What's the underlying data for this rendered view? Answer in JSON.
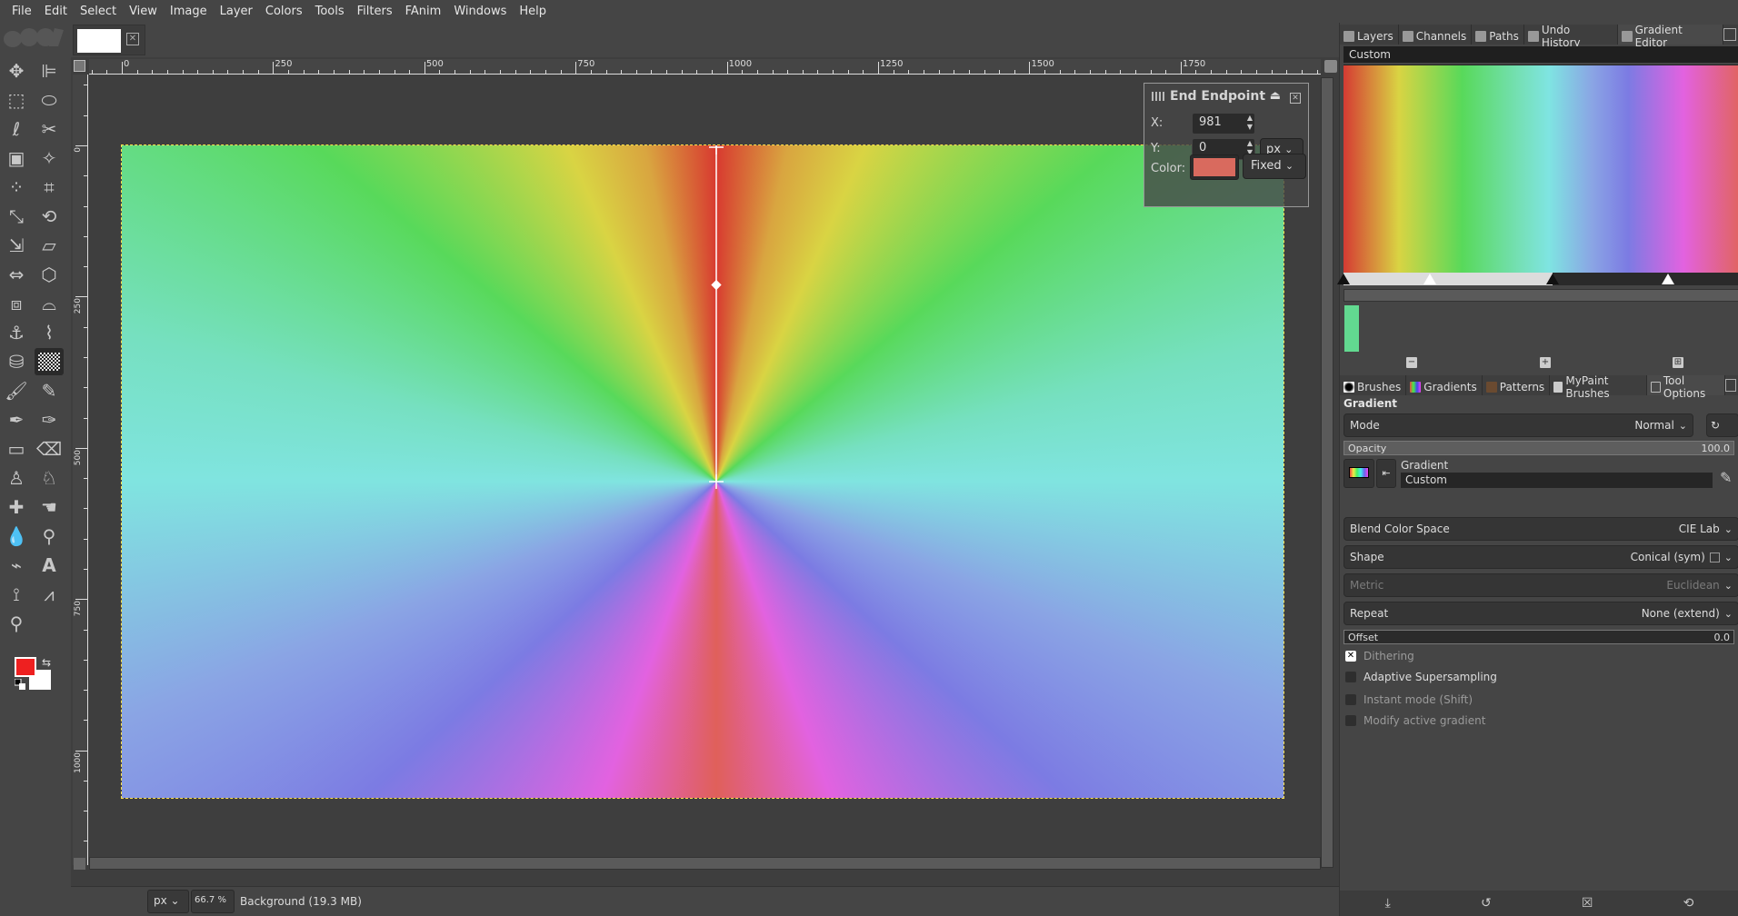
{
  "menubar": [
    "File",
    "Edit",
    "Select",
    "View",
    "Image",
    "Layer",
    "Colors",
    "Tools",
    "Filters",
    "FAnim",
    "Windows",
    "Help"
  ],
  "image_tab": {
    "close_icon": "close-box-icon"
  },
  "ruler": {
    "top_labels": [
      "0",
      "250",
      "500",
      "750",
      "1000",
      "1250",
      "1500",
      "1750"
    ],
    "left_labels": [
      "0",
      "250",
      "500",
      "750",
      "1000"
    ]
  },
  "end_endpoint": {
    "title": "End Endpoint",
    "x_label": "X:",
    "x_value": "981",
    "y_label": "Y:",
    "y_value": "0",
    "unit": "px",
    "color_label": "Color:",
    "color": "#d96a5e",
    "color_mode": "Fixed"
  },
  "statusbar": {
    "unit": "px",
    "zoom": "66.7 %",
    "layer_info": "Background (19.3 MB)"
  },
  "colors": {
    "foreground": "#ee2020",
    "background": "#ffffff"
  },
  "top_dock": {
    "tabs": [
      "Layers",
      "Channels",
      "Paths",
      "Undo History",
      "Gradient Editor"
    ],
    "active_tab": "Gradient Editor",
    "gradient_name": "Custom",
    "stop_swatch_color": "#62d990"
  },
  "bottom_dock": {
    "tabs": [
      "Brushes",
      "Gradients",
      "Patterns",
      "MyPaint Brushes",
      "Tool Options"
    ],
    "active_tab": "Tool Options"
  },
  "tool_options": {
    "title": "Gradient",
    "mode_label": "Mode",
    "mode_value": "Normal",
    "opacity_label": "Opacity",
    "opacity_value": "100.0",
    "gradient_label": "Gradient",
    "gradient_value": "Custom",
    "blend_label": "Blend Color Space",
    "blend_value": "CIE Lab",
    "shape_label": "Shape",
    "shape_value": "Conical (sym)",
    "metric_label": "Metric",
    "metric_value": "Euclidean",
    "repeat_label": "Repeat",
    "repeat_value": "None (extend)",
    "offset_label": "Offset",
    "offset_value": "0.0",
    "checkboxes": [
      {
        "label": "Dithering",
        "checked": true
      },
      {
        "label": "Adaptive Supersampling",
        "checked": false
      },
      {
        "label": "Instant mode  (Shift)",
        "checked": false
      },
      {
        "label": "Modify active gradient",
        "checked": false
      }
    ]
  }
}
